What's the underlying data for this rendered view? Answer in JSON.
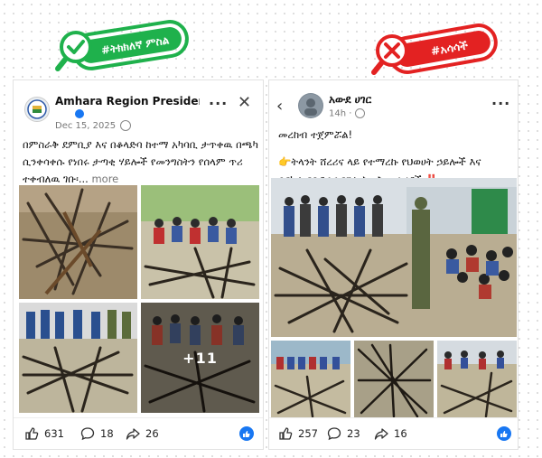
{
  "stamps": {
    "left": {
      "label": "#ትክክለኛ ምስል",
      "color": "#1fb14c"
    },
    "right": {
      "label": "#አሳሳች",
      "color": "#e32222"
    }
  },
  "left_post": {
    "author": "Amhara Region President Of...",
    "date": "Dec 15, 2025",
    "text_line1": "በምስራቅ ደምቢያ እና በቆላድባ ከተማ አካባቢ ታጥቀዉ በጫካ",
    "text_line2": "ሲንቀሳቀሱ የነበሩ ታጣቂ ሃይሎች  የመንግስትን የሰላም ጥሪ",
    "text_line3": "ተቀብለዉ ገቡ፡...",
    "more": "more",
    "extra_photos": "+11",
    "reactions": "631",
    "comments": "18",
    "shares": "26",
    "colors": {
      "like_blue": "#1877f2",
      "verified": "#1877f2"
    }
  },
  "right_post": {
    "author": "አውደ ሀገር",
    "time": "14h · ",
    "text_line1": "መረከብ ተጀምሯል!",
    "text_line2": "👉ትላንት ሸረሪና ላይ የተማረኩ የህወሀት ኃይሎች እና",
    "text_line3": "በርካታ የቡድንና የግል ትጥቅ መሳሪያች",
    "exclaim": "‼️",
    "reactions": "257",
    "comments": "23",
    "shares": "16"
  },
  "icons": [
    "magnifier-check-icon",
    "magnifier-x-icon",
    "back-arrow-icon",
    "more-dots-icon",
    "close-icon",
    "globe-icon",
    "verified-icon",
    "like-icon",
    "comment-icon",
    "share-icon",
    "like-reaction-icon"
  ]
}
